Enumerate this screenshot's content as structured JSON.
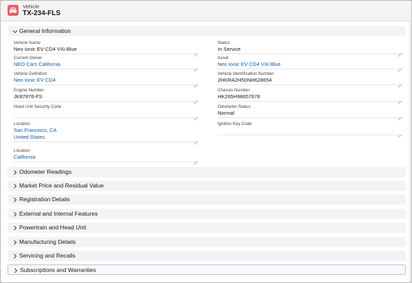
{
  "header": {
    "object_type": "Vehicle",
    "record_name": "TX-234-FLS",
    "icon": "car-icon",
    "icon_color": "#e8616c"
  },
  "general": {
    "title": "General Information",
    "left": [
      {
        "label": "Vehicle Name",
        "values": [
          "Neo Ionic EV CD4 VXi Blue"
        ],
        "link": false
      },
      {
        "label": "Current Owner",
        "values": [
          "NEO Cars California"
        ],
        "link": true
      },
      {
        "label": "Vehicle Definition",
        "values": [
          "Neo Ionic EV CD4"
        ],
        "link": true
      },
      {
        "label": "Engine Number",
        "values": [
          "JK87876-FS"
        ],
        "link": false
      },
      {
        "label": "Head Unit Security Code",
        "values": [],
        "link": false
      },
      {
        "label": "Location",
        "values": [
          "San Francisco, CA",
          "United States"
        ],
        "link": true
      },
      {
        "label": "Location",
        "values": [
          "California"
        ],
        "link": true
      }
    ],
    "right": [
      {
        "label": "Status",
        "values": [
          "In Service"
        ],
        "link": false
      },
      {
        "label": "Asset",
        "values": [
          "Neo Ionic EV CD4 VXi Blue"
        ],
        "link": true
      },
      {
        "label": "Vehicle Identification Number",
        "values": [
          "2HKRA2H50NH628654"
        ],
        "link": false
      },
      {
        "label": "Chassis Number",
        "values": [
          "HK265H98657678"
        ],
        "link": false
      },
      {
        "label": "Odometer Status",
        "values": [
          "Normal"
        ],
        "link": false
      },
      {
        "label": "Ignition Key Code",
        "values": [],
        "link": false
      }
    ]
  },
  "sections": [
    {
      "label": "Odometer Readings"
    },
    {
      "label": "Market Price and Residual Value"
    },
    {
      "label": "Registration Details"
    },
    {
      "label": "External and Internal Features"
    },
    {
      "label": "Powertrain and Head Unit"
    },
    {
      "label": "Manufacturing Details"
    },
    {
      "label": "Servicing and Recalls"
    },
    {
      "label": "Subscriptions and Warranties"
    }
  ],
  "colors": {
    "link": "#0b5cab",
    "section_bg": "#f3f3f3"
  }
}
